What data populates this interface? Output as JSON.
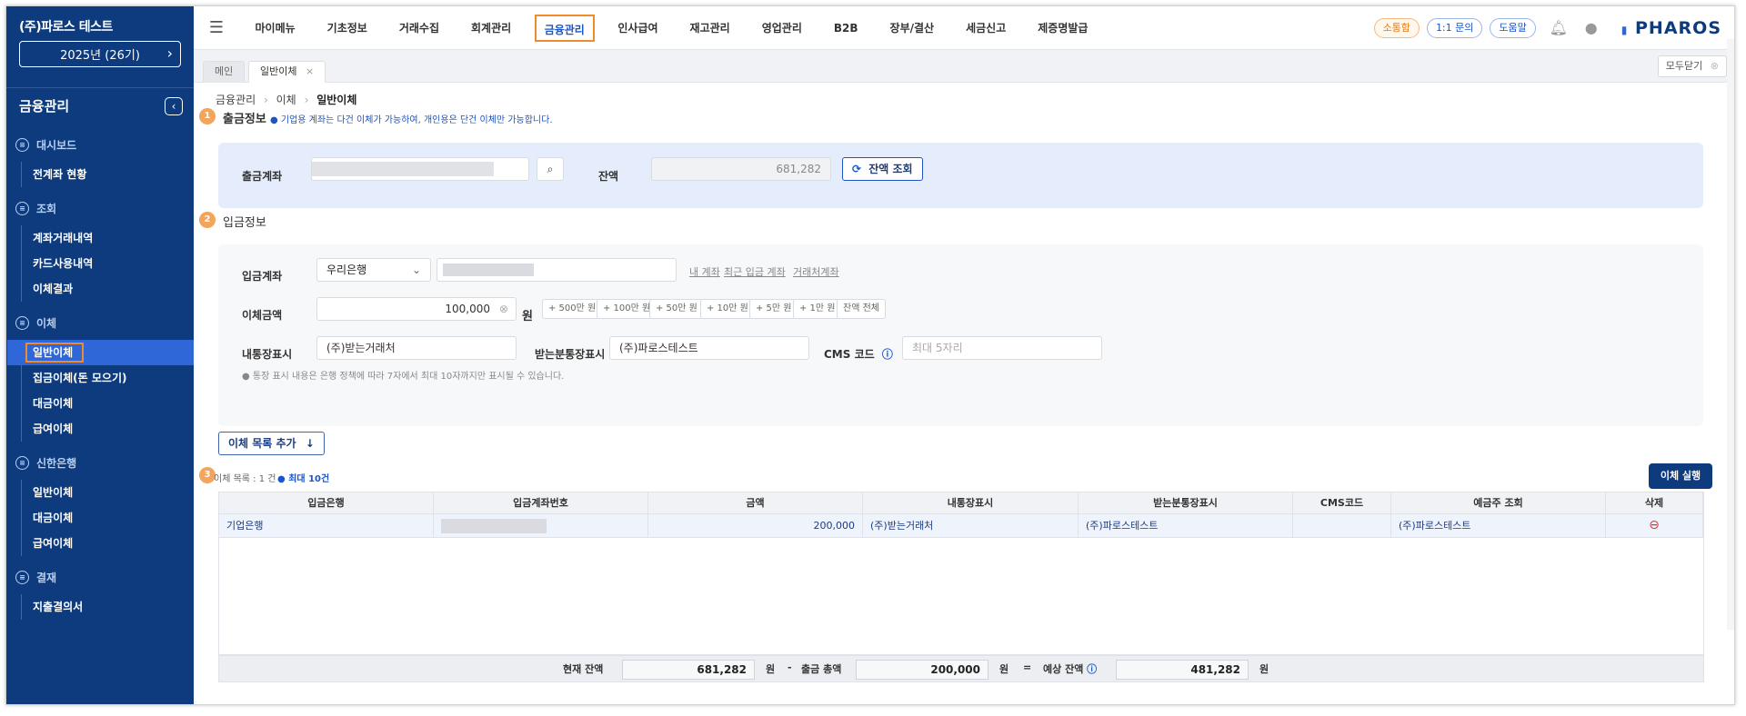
{
  "company": {
    "name": "(주)파로스 테스트",
    "year": "2025년 (26기)"
  },
  "sidebar": {
    "title": "금융관리",
    "sections": [
      {
        "label": "대시보드",
        "items": [
          "전계좌 현황"
        ]
      },
      {
        "label": "조회",
        "items": [
          "계좌거래내역",
          "카드사용내역",
          "이체결과"
        ]
      },
      {
        "label": "이체",
        "items": [
          "일반이체",
          "집금이체(돈 모으기)",
          "대금이체",
          "급여이체"
        ]
      },
      {
        "label": "신한은행",
        "items": [
          "일반이체",
          "대금이체",
          "급여이체"
        ]
      },
      {
        "label": "결재",
        "items": [
          "지출결의서"
        ]
      }
    ]
  },
  "topnav": {
    "menu": [
      "마이메뉴",
      "기초정보",
      "거래수집",
      "회계관리",
      "금융관리",
      "인사급여",
      "재고관리",
      "영업관리",
      "B2B",
      "장부/결산",
      "세금신고",
      "제증명발급"
    ],
    "active": "금융관리",
    "pills": [
      "소통함",
      "1:1 문의",
      "도움말"
    ],
    "logo": "PHAROS"
  },
  "tabs": {
    "main": "메인",
    "current": "일반이체",
    "close_all": "모두닫기"
  },
  "breadcrumb": [
    "금융관리",
    "이체",
    "일반이체"
  ],
  "withdraw": {
    "num": "1",
    "title": "출금정보",
    "note": "● 기업용 계좌는 다건 이체가 가능하여, 개인용은 단건 이체만 가능합니다.",
    "account_label": "출금계좌",
    "balance_label": "잔액",
    "balance": "681,282",
    "balance_btn": "잔액 조회"
  },
  "deposit": {
    "num": "2",
    "title": "입금정보",
    "account_label": "입금계좌",
    "bank": "우리은행",
    "links": [
      "내 계좌",
      "최근 입금 계좌",
      "거래처계좌"
    ],
    "amount_label": "이체금액",
    "amount": "100,000",
    "unit": "원",
    "chips": [
      "+ 500만 원",
      "+ 100만 원",
      "+ 50만 원",
      "+ 10만 원",
      "+ 5만 원",
      "+ 1만 원",
      "잔액 전체"
    ],
    "memo_label": "내통장표시",
    "memo": "(주)받는거래처",
    "recv_label": "받는분통장표시",
    "recv": "(주)파로스테스트",
    "cms_label": "CMS 코드",
    "cms_placeholder": "최대 5자리",
    "note": "● 통장 표시 내용은 은행 정책에 따라 7자에서 최대 10자까지만 표시될 수 있습니다."
  },
  "add_btn": "이체 목록 추가",
  "list": {
    "num": "3",
    "count": "이체 목록 : 1 건",
    "max": "● 최대 10건",
    "run_btn": "이체 실행",
    "columns": [
      "입금은행",
      "입금계좌번호",
      "금액",
      "내통장표시",
      "받는분통장표시",
      "CMS코드",
      "예금주 조회",
      "삭제"
    ],
    "rows": [
      {
        "bank": "기업은행",
        "amount": "200,000",
        "memo": "(주)받는거래처",
        "recv": "(주)파로스테스트",
        "cms": "",
        "holder": "(주)파로스테스트"
      }
    ]
  },
  "summary": {
    "cur_label": "현재 잔액",
    "cur": "681,282",
    "unit": "원",
    "minus": "-",
    "out_label": "출금 총액",
    "out": "200,000",
    "eq": "=",
    "exp_label": "예상 잔액",
    "exp": "481,282"
  }
}
